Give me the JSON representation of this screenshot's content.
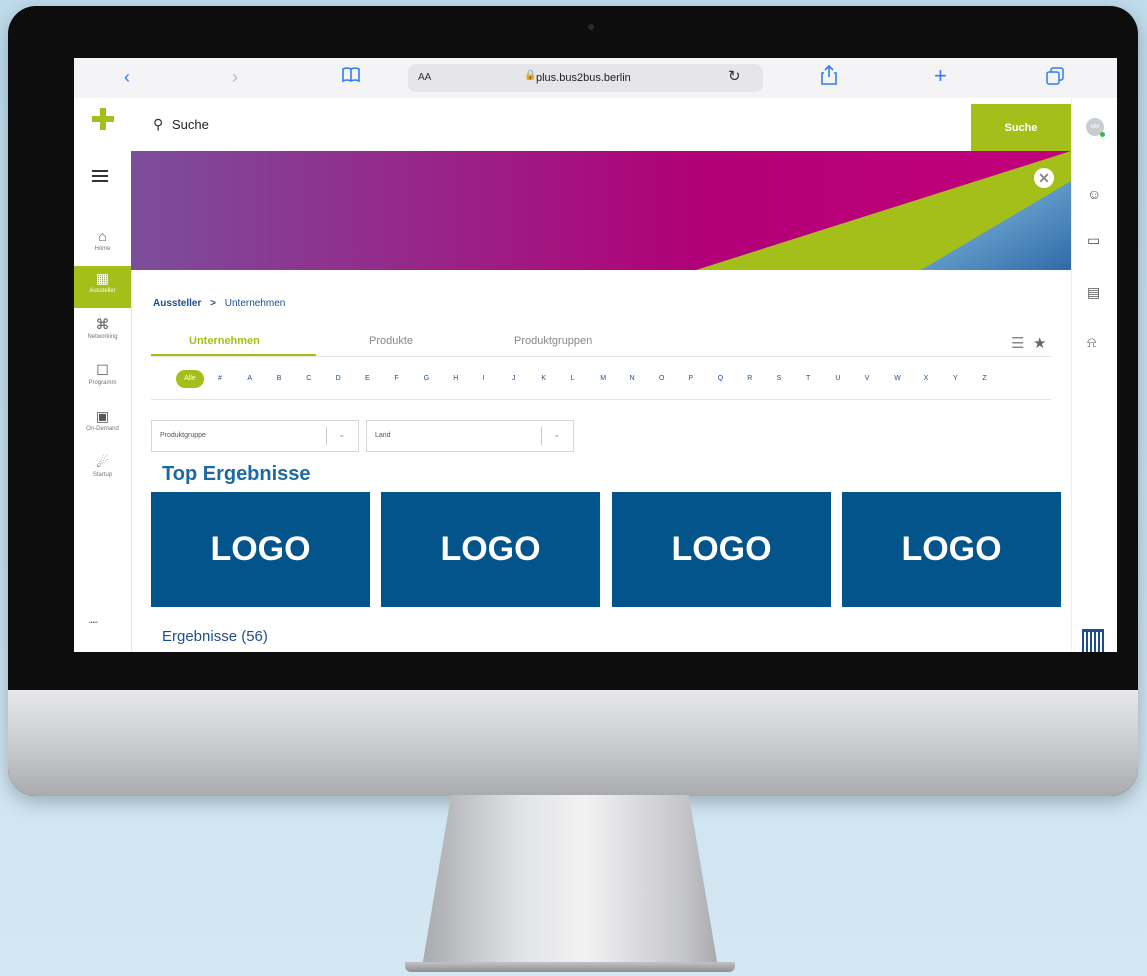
{
  "browser": {
    "text_size_label": "AA",
    "url": "plus.bus2bus.berlin",
    "icons": [
      "chevron-left-icon",
      "chevron-right-icon",
      "bookmarks-icon",
      "lock-icon",
      "reload-icon",
      "share-icon",
      "new-tab-icon",
      "tabs-icon"
    ]
  },
  "search": {
    "placeholder": "Suche",
    "button_label": "Suche"
  },
  "sidebar": {
    "items": [
      {
        "label": "Home",
        "icon": "home-icon"
      },
      {
        "label": "Aussteller",
        "icon": "exhibitors-icon",
        "active": true
      },
      {
        "label": "Networking",
        "icon": "networking-icon"
      },
      {
        "label": "Programm",
        "icon": "program-icon"
      },
      {
        "label": "On-Demand",
        "icon": "on-demand-icon"
      },
      {
        "label": "Startup",
        "icon": "startup-icon"
      }
    ]
  },
  "rightbar": {
    "avatar_initials": "MM",
    "icons": [
      "user-icon",
      "chat-icon",
      "calendar-icon",
      "bell-icon",
      "building-icon"
    ]
  },
  "breadcrumb": {
    "parent": "Aussteller",
    "separator": ">",
    "current": "Unternehmen"
  },
  "tabs": [
    {
      "label": "Unternehmen",
      "active": true
    },
    {
      "label": "Produkte",
      "active": false
    },
    {
      "label": "Produktgruppen",
      "active": false
    }
  ],
  "alphabet": {
    "all_label": "Alle",
    "letters": [
      "#",
      "A",
      "B",
      "C",
      "D",
      "E",
      "F",
      "G",
      "H",
      "I",
      "J",
      "K",
      "L",
      "M",
      "N",
      "O",
      "P",
      "Q",
      "R",
      "S",
      "T",
      "U",
      "V",
      "W",
      "X",
      "Y",
      "Z"
    ]
  },
  "filters": {
    "product_group_placeholder": "Produktgruppe",
    "country_placeholder": "Land"
  },
  "top_results": {
    "title": "Top Ergebnisse",
    "logos": [
      "LOGO",
      "LOGO",
      "LOGO",
      "LOGO"
    ]
  },
  "results": {
    "title": "Ergebnisse (56)"
  },
  "colors": {
    "accent": "#a5bf1a",
    "brand_blue": "#03548a",
    "link_blue": "#1d4e8f",
    "banner_gradient": [
      "#7b4e9b",
      "#b10078",
      "#a5bf1a",
      "#5aa0d0"
    ]
  }
}
